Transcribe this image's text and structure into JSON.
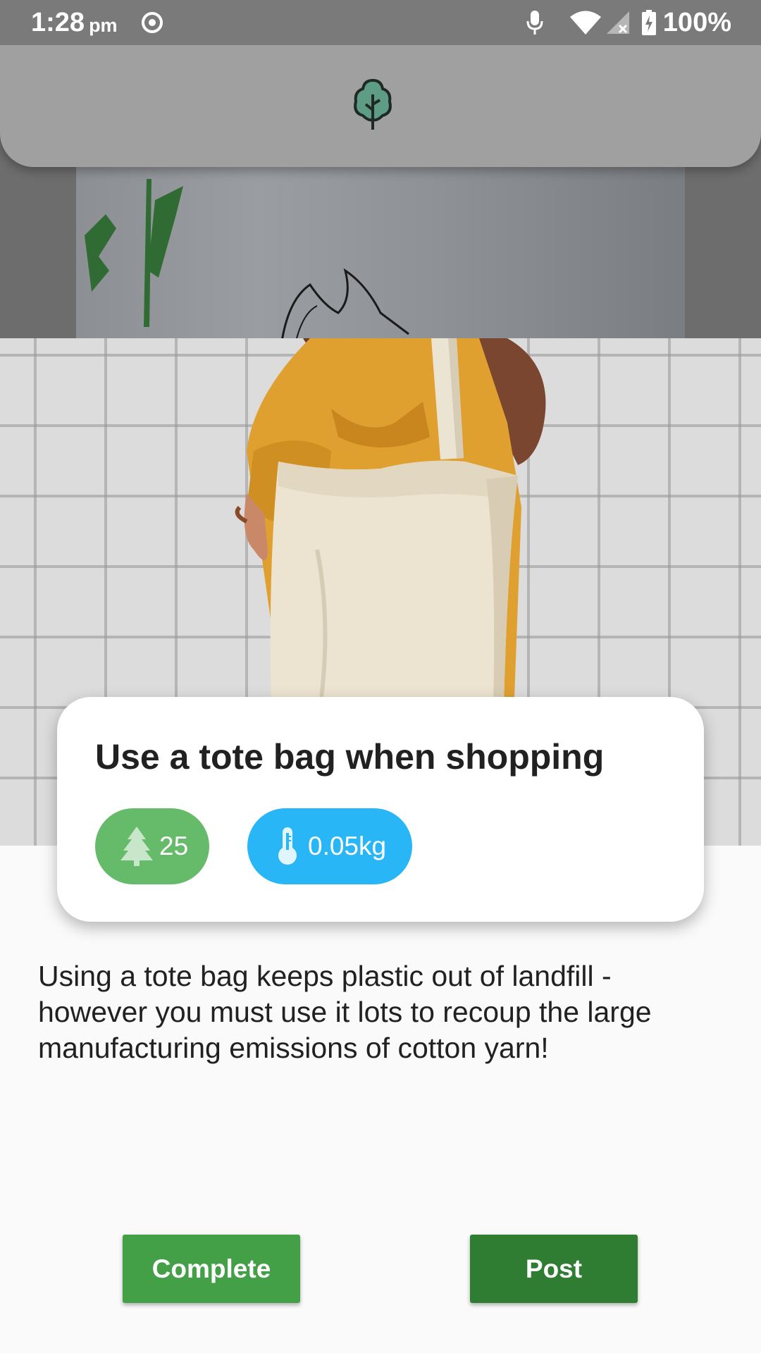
{
  "status_bar": {
    "time": "1:28",
    "ampm": "pm",
    "battery": "100%",
    "icons": [
      "record-icon",
      "mic-icon",
      "wifi-icon",
      "signal-icon",
      "battery-charging-icon"
    ]
  },
  "app_bar": {
    "logo_icon": "tree-icon"
  },
  "card": {
    "title": "Use a tote bag when shopping",
    "points": "25",
    "points_icon": "pine-tree-icon",
    "co2": "0.05kg",
    "co2_icon": "thermometer-icon"
  },
  "description": "Using a tote bag keeps plastic out of landfill - however you must use it lots to recoup the large manufacturing emissions of cotton yarn!",
  "actions": {
    "complete_label": "Complete",
    "post_label": "Post"
  },
  "colors": {
    "points_pill": "#66bb6a",
    "co2_pill": "#29b6f6",
    "complete_button": "#43a047",
    "post_button": "#2e7d32"
  }
}
